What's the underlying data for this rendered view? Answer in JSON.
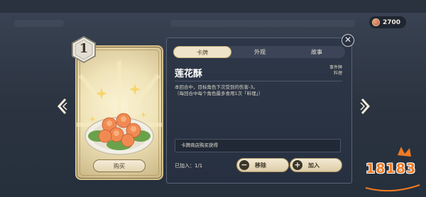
{
  "currency": {
    "icon": "coin-icon",
    "amount": "2700"
  },
  "card": {
    "cost": "1",
    "buy_label": "购买",
    "accent": "#d9c38c"
  },
  "panel": {
    "tabs": [
      {
        "label": "卡牌",
        "active": true
      },
      {
        "label": "外观",
        "active": false
      },
      {
        "label": "故事",
        "active": false
      }
    ],
    "name": "莲花酥",
    "tags": [
      "事件牌",
      "料理"
    ],
    "description_lines": [
      "本回合中，目标角色下次受到的伤害-3。",
      "（每回合中每个角色最多食用1次「料理」）"
    ],
    "source": "卡牌商店购买获得",
    "added_label": "已加入：1/1",
    "remove_label": "移除",
    "add_label": "加入"
  },
  "watermark": {
    "text": "18183"
  }
}
